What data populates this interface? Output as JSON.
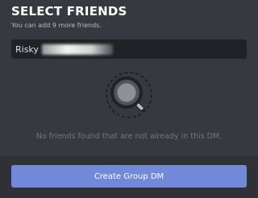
{
  "header": {
    "title": "SELECT FRIENDS",
    "subtitle": "You can add 9 more friends."
  },
  "search": {
    "value": "Risky"
  },
  "empty_state": {
    "icon": "magnifier-icon",
    "message": "No friends found that are not already in this DM."
  },
  "footer": {
    "create_label": "Create Group DM"
  },
  "colors": {
    "background": "#36393f",
    "footer": "#2f3136",
    "input": "#202225",
    "accent": "#7289da"
  }
}
